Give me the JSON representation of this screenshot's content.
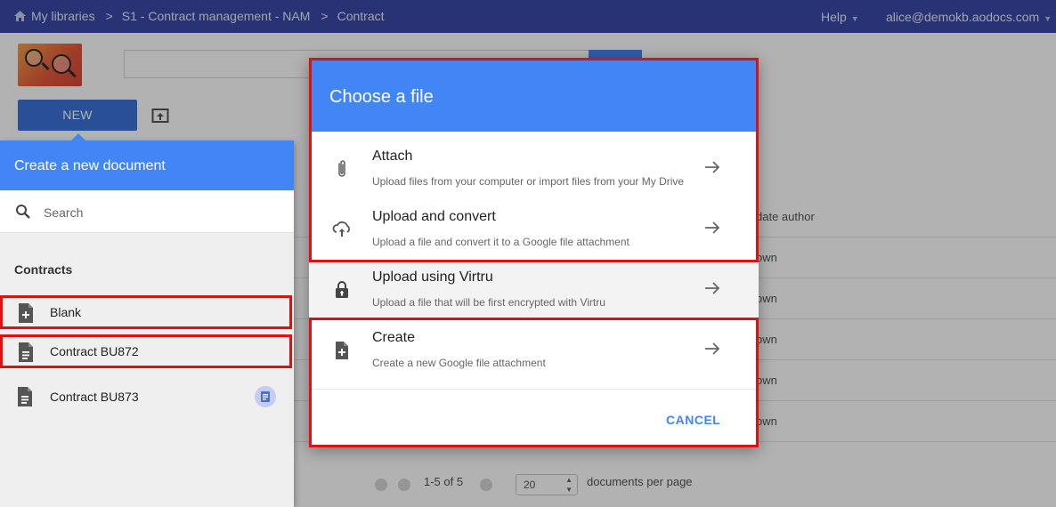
{
  "topbar": {
    "crumb_home": "My libraries",
    "crumb_sep": ">",
    "crumb_library": "S1 - Contract management - NAM",
    "crumb_class": "Contract",
    "help": "Help",
    "user": "alice@demokb.aodocs.com",
    "caret": "▼"
  },
  "toolbar": {
    "new_label": "NEW"
  },
  "background": {
    "column_header": "date author",
    "row_value": "own",
    "pager_range": "1-5 of 5",
    "per_page_value": "20",
    "per_page_label": "documents per page"
  },
  "left_panel": {
    "title": "Create a new document",
    "search_placeholder": "Search",
    "section": "Contracts",
    "items": [
      {
        "label": "Blank"
      },
      {
        "label": "Contract BU872"
      },
      {
        "label": "Contract BU873"
      }
    ]
  },
  "dialog": {
    "title": "Choose a file",
    "options": [
      {
        "title": "Attach",
        "desc": "Upload files from your computer or import files from your My Drive"
      },
      {
        "title": "Upload and convert",
        "desc": "Upload a file and convert it to a Google file attachment"
      },
      {
        "title": "Upload using Virtru",
        "desc": "Upload a file that will be first encrypted with Virtru"
      },
      {
        "title": "Create",
        "desc": "Create a new Google file attachment"
      }
    ],
    "cancel_label": "CANCEL"
  },
  "colors": {
    "topbar": "#3a4aa8",
    "accent": "#4285f4",
    "highlight_border": "#e01010"
  }
}
